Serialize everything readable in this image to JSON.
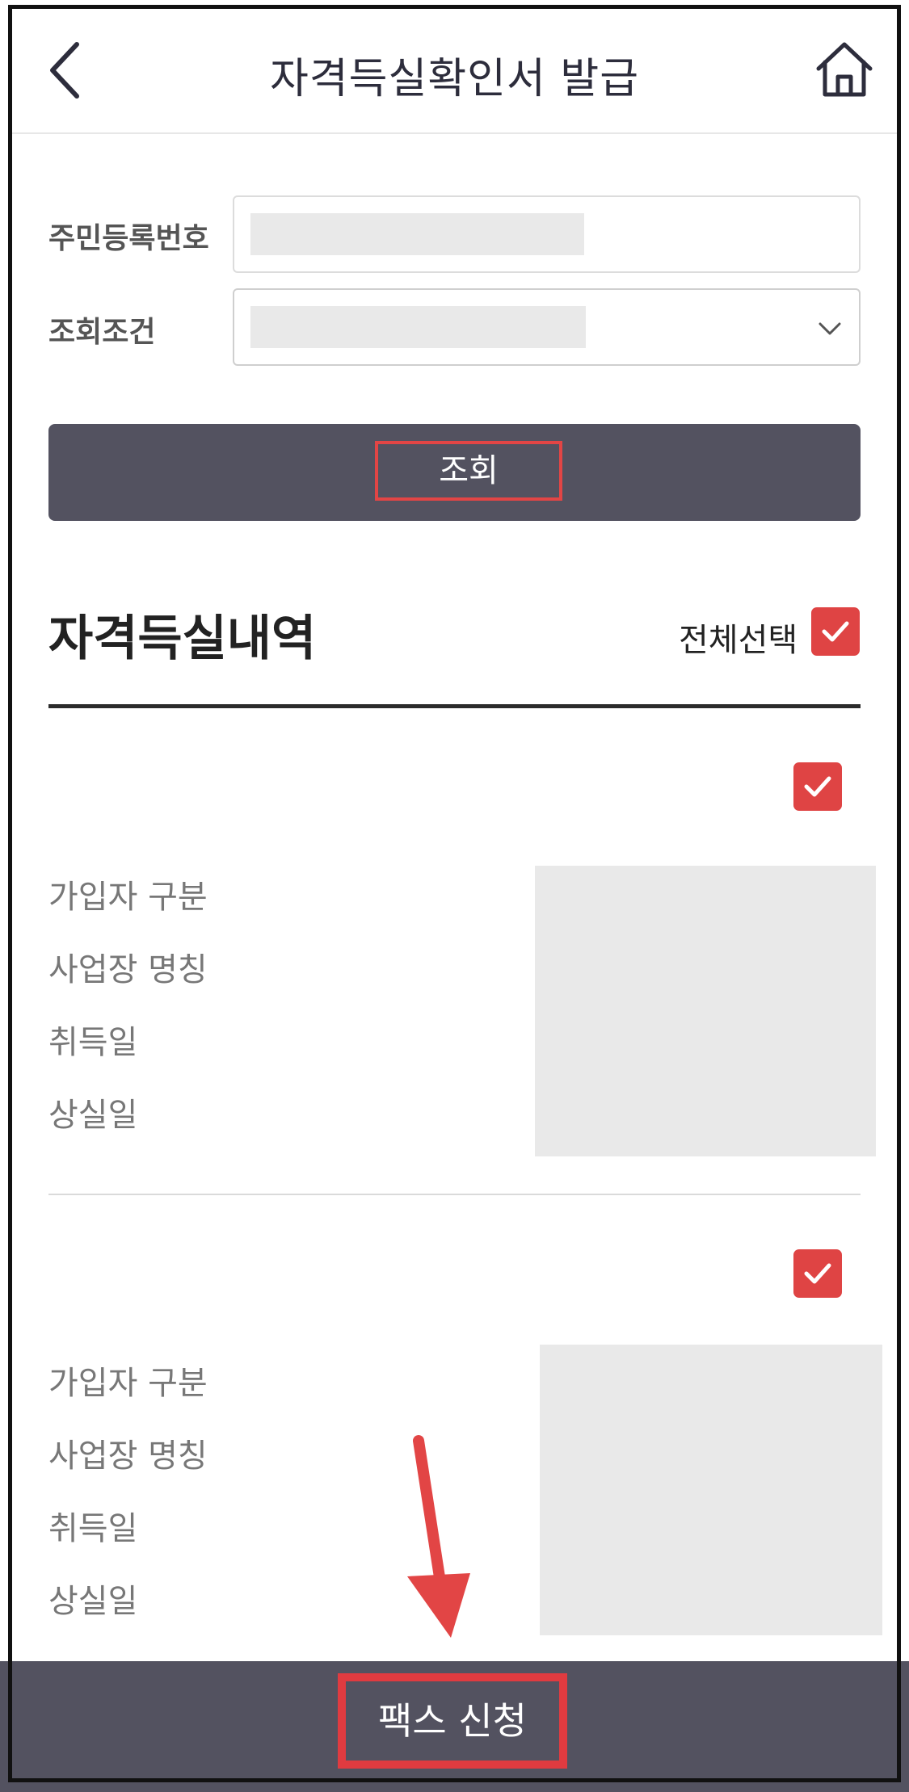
{
  "header": {
    "title": "자격득실확인서 발급",
    "back_icon": "chevron-left-icon",
    "home_icon": "home-icon"
  },
  "form": {
    "resident_number_label": "주민등록번호",
    "condition_label": "조회조건",
    "search_button_label": "조회"
  },
  "history": {
    "title": "자격득실내역",
    "select_all_label": "전체선택",
    "select_all_checked": true,
    "records": [
      {
        "checked": true,
        "fields": [
          "가입자 구분",
          "사업장 명칭",
          "취득일",
          "상실일"
        ]
      },
      {
        "checked": true,
        "fields": [
          "가입자 구분",
          "사업장 명칭",
          "취득일",
          "상실일"
        ]
      }
    ]
  },
  "footer": {
    "fax_button_label": "팩스 신청"
  },
  "colors": {
    "accent": "#df4444",
    "button_dark": "#535260",
    "highlight_red": "#e24545"
  }
}
